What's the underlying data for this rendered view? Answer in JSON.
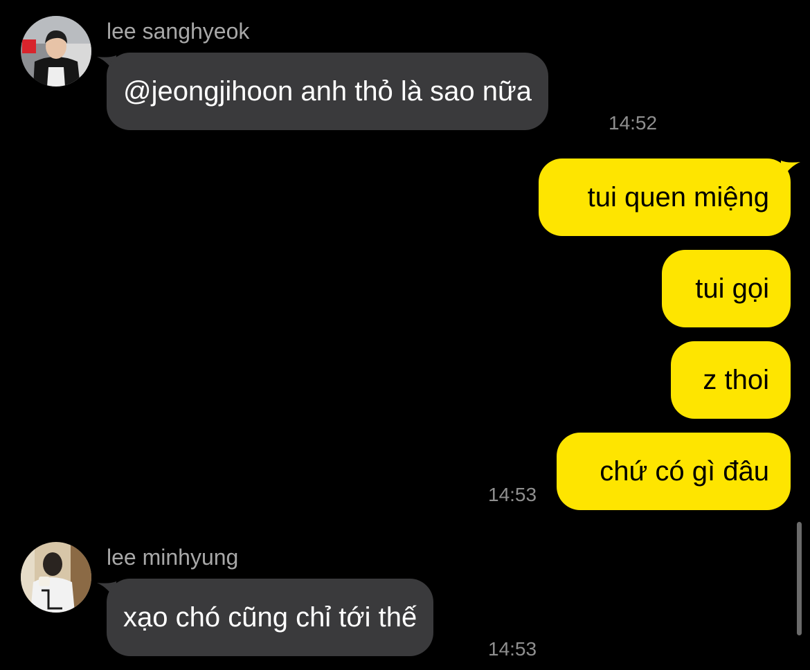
{
  "colors": {
    "background": "#000000",
    "incoming_bubble": "#3a3a3c",
    "outgoing_bubble": "#fee500",
    "sender_name": "#a8a8a8",
    "timestamp": "#8f8f8f"
  },
  "messages": [
    {
      "direction": "incoming",
      "sender": "lee sanghyeok",
      "avatar_icon": "profile-photo",
      "text": "@jeongjihoon anh thỏ là sao nữa",
      "time": "14:52"
    },
    {
      "direction": "outgoing",
      "texts": [
        "tui quen miệng",
        "tui gọi",
        "z thoi",
        "chứ có gì đâu"
      ],
      "time": "14:53"
    },
    {
      "direction": "incoming",
      "sender": "lee minhyung",
      "avatar_icon": "profile-photo",
      "text": "xạo chó cũng chỉ tới thế",
      "time": "14:53"
    }
  ]
}
